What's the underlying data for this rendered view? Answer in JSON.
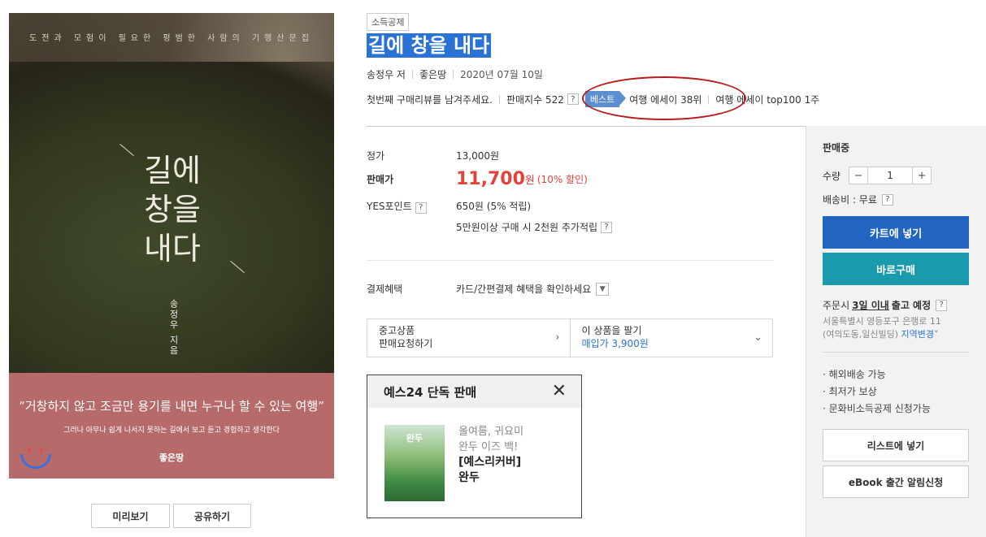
{
  "cover": {
    "tagline": "도전과 모험이 필요한 평범한 사람의 기행산문집",
    "title_lines": [
      "길에",
      "창을",
      "내다"
    ],
    "author": "송정우 지음",
    "quote": "“거창하지 않고 조금만 용기를 내면 누구나 할 수 있는 여행”",
    "subtext": "그러나 아무나 쉽게 나서지 못하는 길에서 보고 듣고 경험하고 생각한다",
    "publisher_logo": "좋은땅"
  },
  "buttons": {
    "preview": "미리보기",
    "share": "공유하기"
  },
  "product": {
    "badge": "소득공제",
    "title": "길에 창을 내다",
    "author": "송정우 저",
    "publisher": "좋은땅",
    "date": "2020년 07월 10일",
    "review_prompt": "첫번째 구매리뷰를 남겨주세요.",
    "sales_index": "판매지수 522",
    "best_label": "베스트",
    "rank1": "여행 에세이 38위",
    "rank2": "여행 에세이 top100 1주"
  },
  "pricing": {
    "list_label": "정가",
    "list_price": "13,000원",
    "sale_label": "판매가",
    "sale_price": "11,700",
    "sale_unit": "원",
    "discount": "(10% 할인)",
    "points_label": "YES포인트",
    "points": "650원 (5% 적립)",
    "bonus": "5만원이상 구매 시 2천원 추가적립",
    "payment_label": "결제혜택",
    "payment_text": "카드/간편결제 혜택을 확인하세요"
  },
  "used": {
    "left_line1": "중고상품",
    "left_line2": "판매요청하기",
    "right_line1": "이 상품을 팔기",
    "right_line2": "매입가 3,900원"
  },
  "exclusive": {
    "header": "예스24 단독 판매",
    "thumb_title": "완두",
    "line1": "올여름, 귀요미",
    "line2": "완두 이즈 백!",
    "line3": "[예스리커버]",
    "line4": "완두"
  },
  "panel": {
    "status": "판매중",
    "qty_label": "수량",
    "qty_value": "1",
    "shipping": "배송비 : 무료",
    "cart": "카트에 넣기",
    "buy": "바로구매",
    "order_prefix": "주문시",
    "order_days": "3일 이내",
    "order_suffix": "출고 예정",
    "addr1": "서울특별시 영등포구 은행로 11",
    "addr2": "(여의도동,일신빌딩)",
    "addr_change": "지역변경",
    "features": [
      "· 해외배송 가능",
      "· 최저가 보상",
      "· 문화비소득공제 신청가능"
    ],
    "wishlist": "리스트에 넣기",
    "ebook": "eBook 출간 알림신청"
  },
  "colors": {
    "accent_blue": "#2265c0",
    "teal": "#1a9bad",
    "price_red": "#e5413b",
    "highlight": "#2a73d4"
  },
  "icons": {
    "help": "question-icon",
    "close": "close-icon",
    "chevron": "chevron-down-icon"
  }
}
